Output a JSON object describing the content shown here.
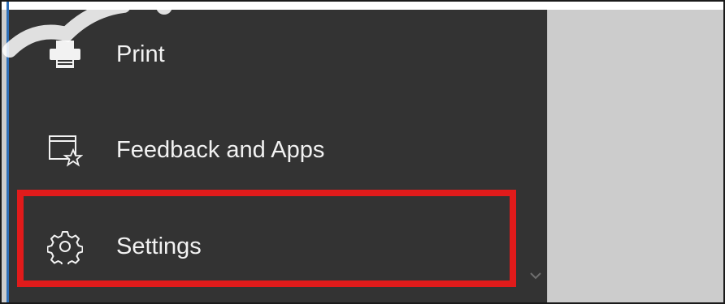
{
  "menu": {
    "items": [
      {
        "label": "Print",
        "icon": "printer-icon"
      },
      {
        "label": "Feedback and Apps",
        "icon": "feedback-star-icon"
      },
      {
        "label": "Settings",
        "icon": "gear-icon"
      }
    ],
    "highlighted_item": "Settings"
  },
  "colors": {
    "panel_background": "#333333",
    "text": "#f2f2f2",
    "highlight_border": "#e01b1b",
    "side_area": "#cccccc",
    "accent": "#2e6fb8"
  }
}
